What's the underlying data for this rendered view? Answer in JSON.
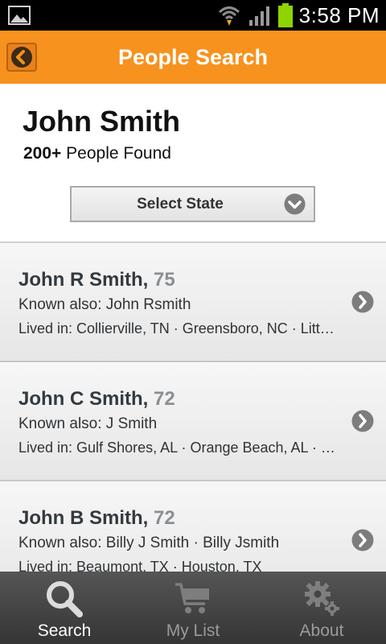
{
  "status_bar": {
    "time": "3:58 PM",
    "icons": [
      "gallery-icon",
      "wifi-icon",
      "signal-icon",
      "battery-icon"
    ]
  },
  "header": {
    "title": "People Search",
    "back_icon": "back-arrow-icon"
  },
  "search": {
    "query": "John Smith",
    "count": "200+",
    "count_suffix": "People Found",
    "state_select_label": "Select State"
  },
  "results": [
    {
      "name": "John R Smith,",
      "age": "75",
      "known_also": "Known also: John Rsmith",
      "lived_in": "Lived in: Collierville, TN · Greensboro, NC · Little Rock, AR"
    },
    {
      "name": "John C Smith,",
      "age": "72",
      "known_also": "Known also: J Smith",
      "lived_in": "Lived in: Gulf Shores, AL · Orange Beach, AL · Mobile, AL"
    },
    {
      "name": "John B Smith,",
      "age": "72",
      "known_also": "Known also: Billy J Smith · Billy Jsmith",
      "lived_in": "Lived in: Beaumont, TX · Houston, TX"
    }
  ],
  "tabs": [
    {
      "label": "Search",
      "icon": "search-icon",
      "active": true
    },
    {
      "label": "My List",
      "icon": "cart-icon",
      "active": false
    },
    {
      "label": "About",
      "icon": "gear-icon",
      "active": false
    }
  ],
  "colors": {
    "accent": "#f7921e",
    "tab_bar": "#454545",
    "row_bg": "#efefef"
  }
}
